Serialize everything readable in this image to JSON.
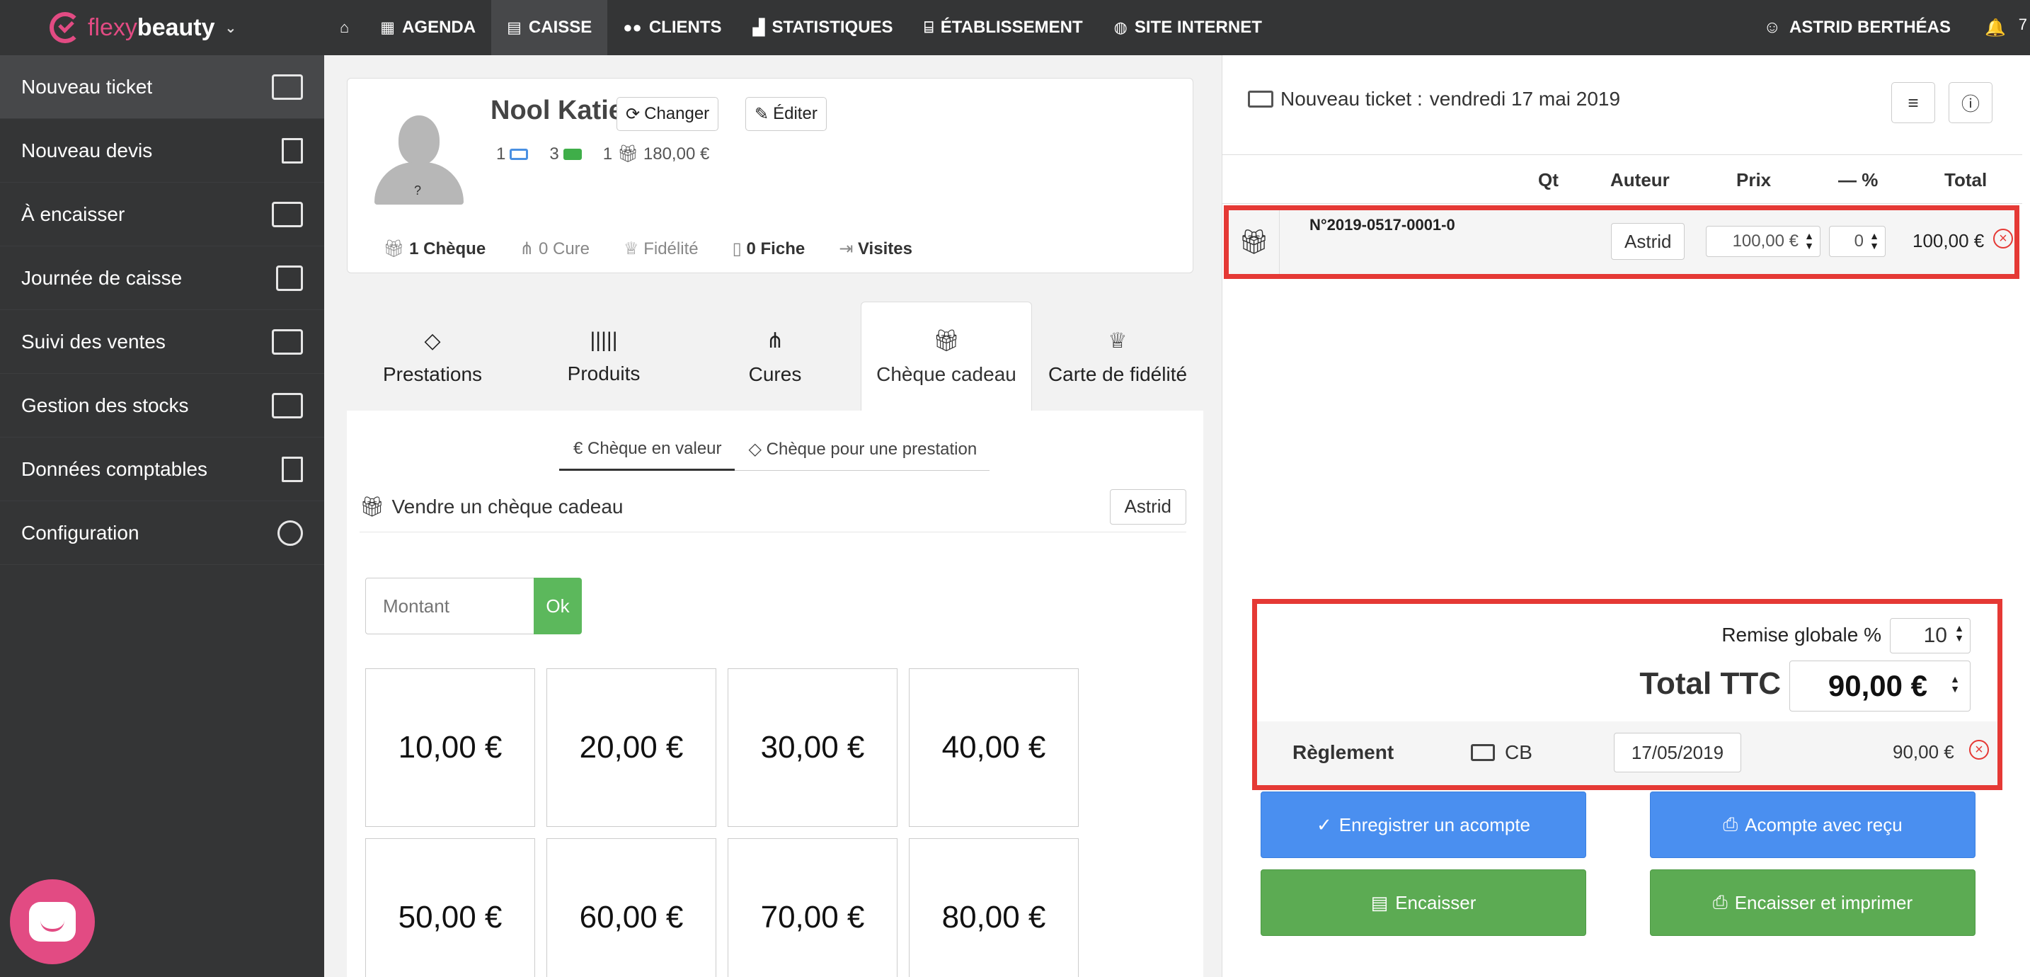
{
  "brand": {
    "name_a": "flexy",
    "name_b": "beauty",
    "accent": "#e24b83"
  },
  "nav": [
    {
      "label": "AGENDA",
      "icon": "calendar-icon"
    },
    {
      "label": "CAISSE",
      "icon": "cash-register-icon"
    },
    {
      "label": "CLIENTS",
      "icon": "users-icon"
    },
    {
      "label": "STATISTIQUES",
      "icon": "chart-icon"
    },
    {
      "label": "ÉTABLISSEMENT",
      "icon": "store-icon"
    },
    {
      "label": "SITE INTERNET",
      "icon": "globe-icon"
    }
  ],
  "user": {
    "name": "ASTRID BERTHÉAS",
    "notif_count": "7"
  },
  "sidebar": [
    {
      "label": "Nouveau ticket"
    },
    {
      "label": "Nouveau devis"
    },
    {
      "label": "À encaisser"
    },
    {
      "label": "Journée de caisse"
    },
    {
      "label": "Suivi des ventes"
    },
    {
      "label": "Gestion des stocks"
    },
    {
      "label": "Données comptables"
    },
    {
      "label": "Configuration"
    }
  ],
  "client": {
    "name": "Nool Katie",
    "change_label": "Changer",
    "edit_label": "Éditer",
    "avatar_mark": "?",
    "count_a": "1",
    "count_b": "3",
    "count_c": "1",
    "balance": "180,00 €",
    "tabs": {
      "cheque_count": "1",
      "cheque": "Chèque",
      "cure_count": "0",
      "cure": "Cure",
      "fidelite": "Fidélité",
      "fiche_count": "0",
      "fiche": "Fiche",
      "visites": "Visites"
    }
  },
  "product_tabs": [
    {
      "label": "Prestations"
    },
    {
      "label": "Produits"
    },
    {
      "label": "Cures"
    },
    {
      "label": "Chèque cadeau"
    },
    {
      "label": "Carte de fidélité"
    }
  ],
  "gift": {
    "subtab_value": "Chèque en valeur",
    "subtab_service": "Chèque pour une prestation",
    "sell_label": "Vendre un chèque cadeau",
    "author": "Astrid",
    "amount_placeholder": "Montant",
    "ok_label": "Ok",
    "amounts": [
      "10,00 €",
      "20,00 €",
      "30,00 €",
      "40,00 €",
      "50,00 €",
      "60,00 €",
      "70,00 €",
      "80,00 €"
    ]
  },
  "ticket": {
    "title": "Nouveau ticket :",
    "date": "vendredi 17 mai 2019",
    "columns": {
      "qt": "Qt",
      "auteur": "Auteur",
      "prix": "Prix",
      "remise": "— %",
      "total": "Total"
    },
    "line": {
      "number": "N°2019-0517-0001-0",
      "author": "Astrid",
      "price": "100,00 €",
      "discount": "0",
      "total": "100,00 €"
    },
    "remise_label": "Remise globale %",
    "remise_value": "10",
    "total_label": "Total TTC",
    "total_value": "90,00 €",
    "reglement_label": "Règlement",
    "payment_mode": "CB",
    "payment_date": "17/05/2019",
    "payment_amount": "90,00 €",
    "buttons": {
      "acompte": "Enregistrer un acompte",
      "acompte_recu": "Acompte avec reçu",
      "encaisser": "Encaisser",
      "encaisser_imprimer": "Encaisser et imprimer"
    },
    "highlight_color": "#e53935"
  }
}
